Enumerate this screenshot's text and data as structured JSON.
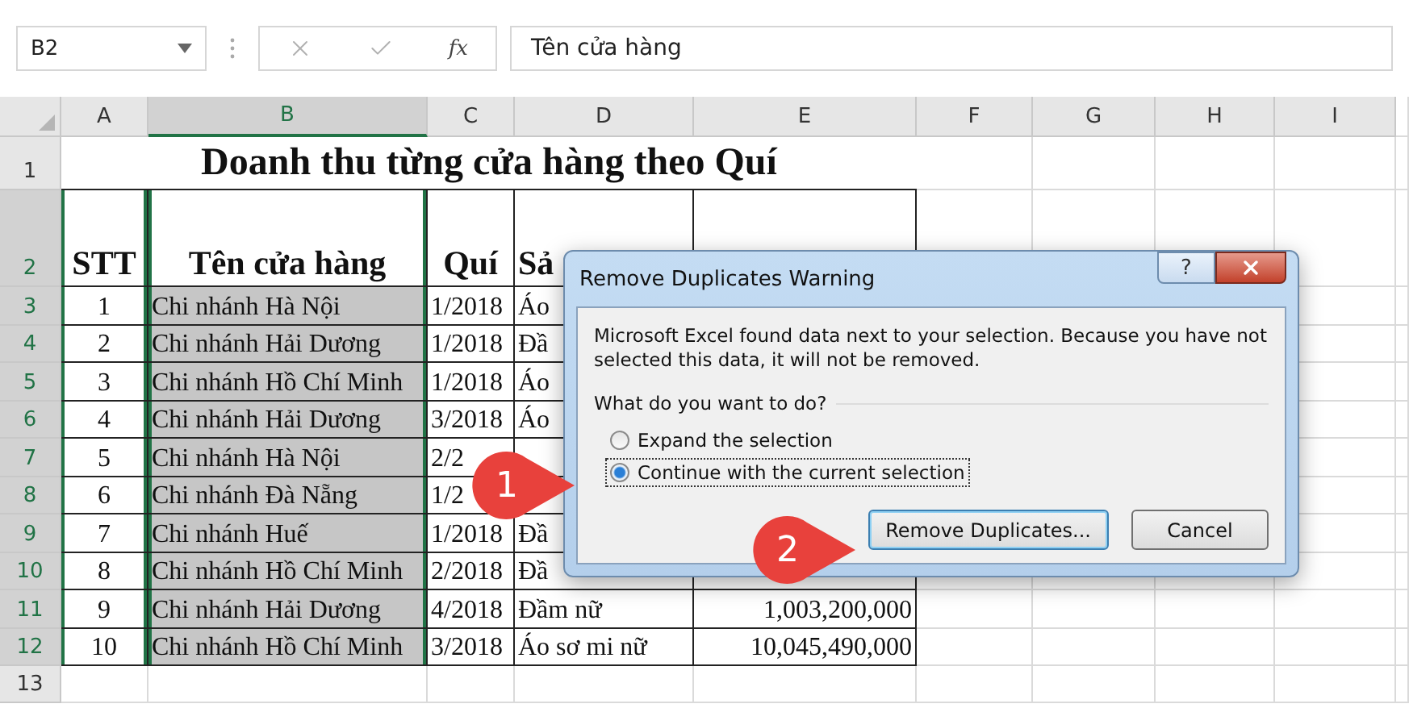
{
  "formula_bar": {
    "name_box": "B2",
    "function_label": "fx",
    "content": "Tên cửa hàng"
  },
  "columns": [
    {
      "label": "A",
      "selected": false
    },
    {
      "label": "B",
      "selected": true
    },
    {
      "label": "C",
      "selected": false
    },
    {
      "label": "D",
      "selected": false
    },
    {
      "label": "E",
      "selected": false
    },
    {
      "label": "F",
      "selected": false
    },
    {
      "label": "G",
      "selected": false
    },
    {
      "label": "H",
      "selected": false
    },
    {
      "label": "I",
      "selected": false
    }
  ],
  "row_numbers": [
    {
      "label": "1",
      "selected": false
    },
    {
      "label": "2",
      "selected": true
    },
    {
      "label": "3",
      "selected": true
    },
    {
      "label": "4",
      "selected": true
    },
    {
      "label": "5",
      "selected": true
    },
    {
      "label": "6",
      "selected": true
    },
    {
      "label": "7",
      "selected": true
    },
    {
      "label": "8",
      "selected": true
    },
    {
      "label": "9",
      "selected": true
    },
    {
      "label": "10",
      "selected": true
    },
    {
      "label": "11",
      "selected": true
    },
    {
      "label": "12",
      "selected": true
    },
    {
      "label": "13",
      "selected": false
    }
  ],
  "title": "Doanh thu từng cửa hàng theo Quí",
  "header": {
    "stt": "STT",
    "store": "Tên cửa hàng",
    "quarter": "Quí",
    "product": "Sả"
  },
  "data": [
    {
      "stt": "1",
      "store": "Chi nhánh Hà Nội",
      "quarter": "1/2018",
      "product": "Áo"
    },
    {
      "stt": "2",
      "store": "Chi nhánh Hải Dương",
      "quarter": "1/2018",
      "product": "Đầ"
    },
    {
      "stt": "3",
      "store": "Chi nhánh Hồ Chí Minh",
      "quarter": "1/2018",
      "product": "Áo"
    },
    {
      "stt": "4",
      "store": "Chi nhánh Hải Dương",
      "quarter": "3/2018",
      "product": "Áo"
    },
    {
      "stt": "5",
      "store": "Chi nhánh Hà Nội",
      "quarter": "2/2"
    },
    {
      "stt": "6",
      "store": "Chi nhánh Đà Nẵng",
      "quarter": "1/2"
    },
    {
      "stt": "7",
      "store": "Chi nhánh Huế",
      "quarter": "1/2018",
      "product": "Đầ"
    },
    {
      "stt": "8",
      "store": "Chi nhánh Hồ Chí Minh",
      "quarter": "2/2018",
      "product": "Đầ"
    },
    {
      "stt": "9",
      "store": "Chi nhánh Hải Dương",
      "quarter": "4/2018",
      "product": "Đầm nữ",
      "revenue": "1,003,200,000"
    },
    {
      "stt": "10",
      "store": "Chi nhánh Hồ Chí Minh",
      "quarter": "3/2018",
      "product": "Áo sơ mi nữ",
      "revenue": "10,045,490,000"
    }
  ],
  "dialog": {
    "title": "Remove Duplicates Warning",
    "help": "?",
    "message": "Microsoft Excel found data next to your selection. Because you have not selected this data, it will not be removed.",
    "question": "What do you want to do?",
    "options": [
      {
        "label": "Expand the selection",
        "selected": false
      },
      {
        "label": "Continue with the current selection",
        "selected": true
      }
    ],
    "buttons": [
      {
        "label": "Remove Duplicates...",
        "default": true
      },
      {
        "label": "Cancel",
        "default": false
      }
    ]
  },
  "steps": [
    "1",
    "2"
  ]
}
